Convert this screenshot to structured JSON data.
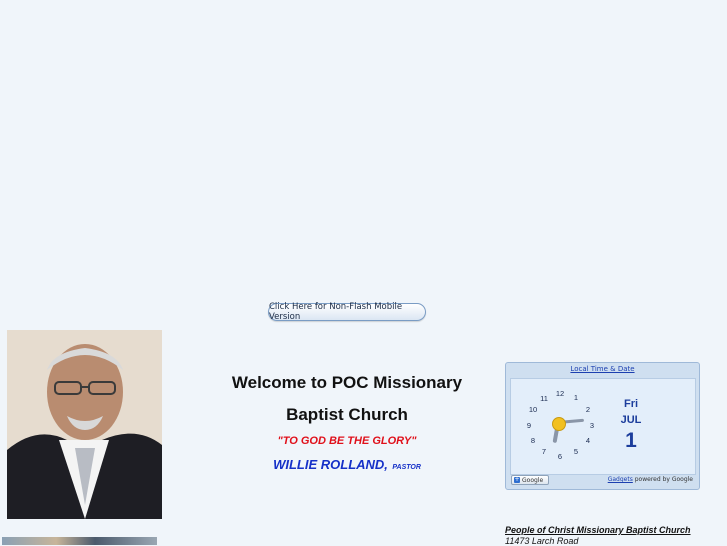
{
  "mobile_button": {
    "label": "Click Here for Non-Flash Mobile Version"
  },
  "welcome": {
    "line1": "Welcome to POC Missionary",
    "line2": "Baptist Church",
    "motto": "\"TO GOD BE THE GLORY\"",
    "pastor_name": "WILLIE ROLLAND,",
    "pastor_title": "PASTOR"
  },
  "gadget": {
    "title": "Local Time & Date",
    "clock_numbers": [
      "12",
      "1",
      "2",
      "3",
      "4",
      "5",
      "6",
      "7",
      "8",
      "9",
      "10",
      "11"
    ],
    "day": "Fri",
    "month": "JUL",
    "date": "1",
    "google_button": "Google",
    "powered_link": "Gadgets",
    "powered_text": "powered by Google"
  },
  "address": {
    "name": "People of Christ Missionary Baptist Church",
    "road": "11473 Larch Road"
  },
  "colors": {
    "background": "#f0f5fa",
    "motto": "#e0101a",
    "pastor": "#1530c8",
    "link": "#1c3fb0"
  }
}
